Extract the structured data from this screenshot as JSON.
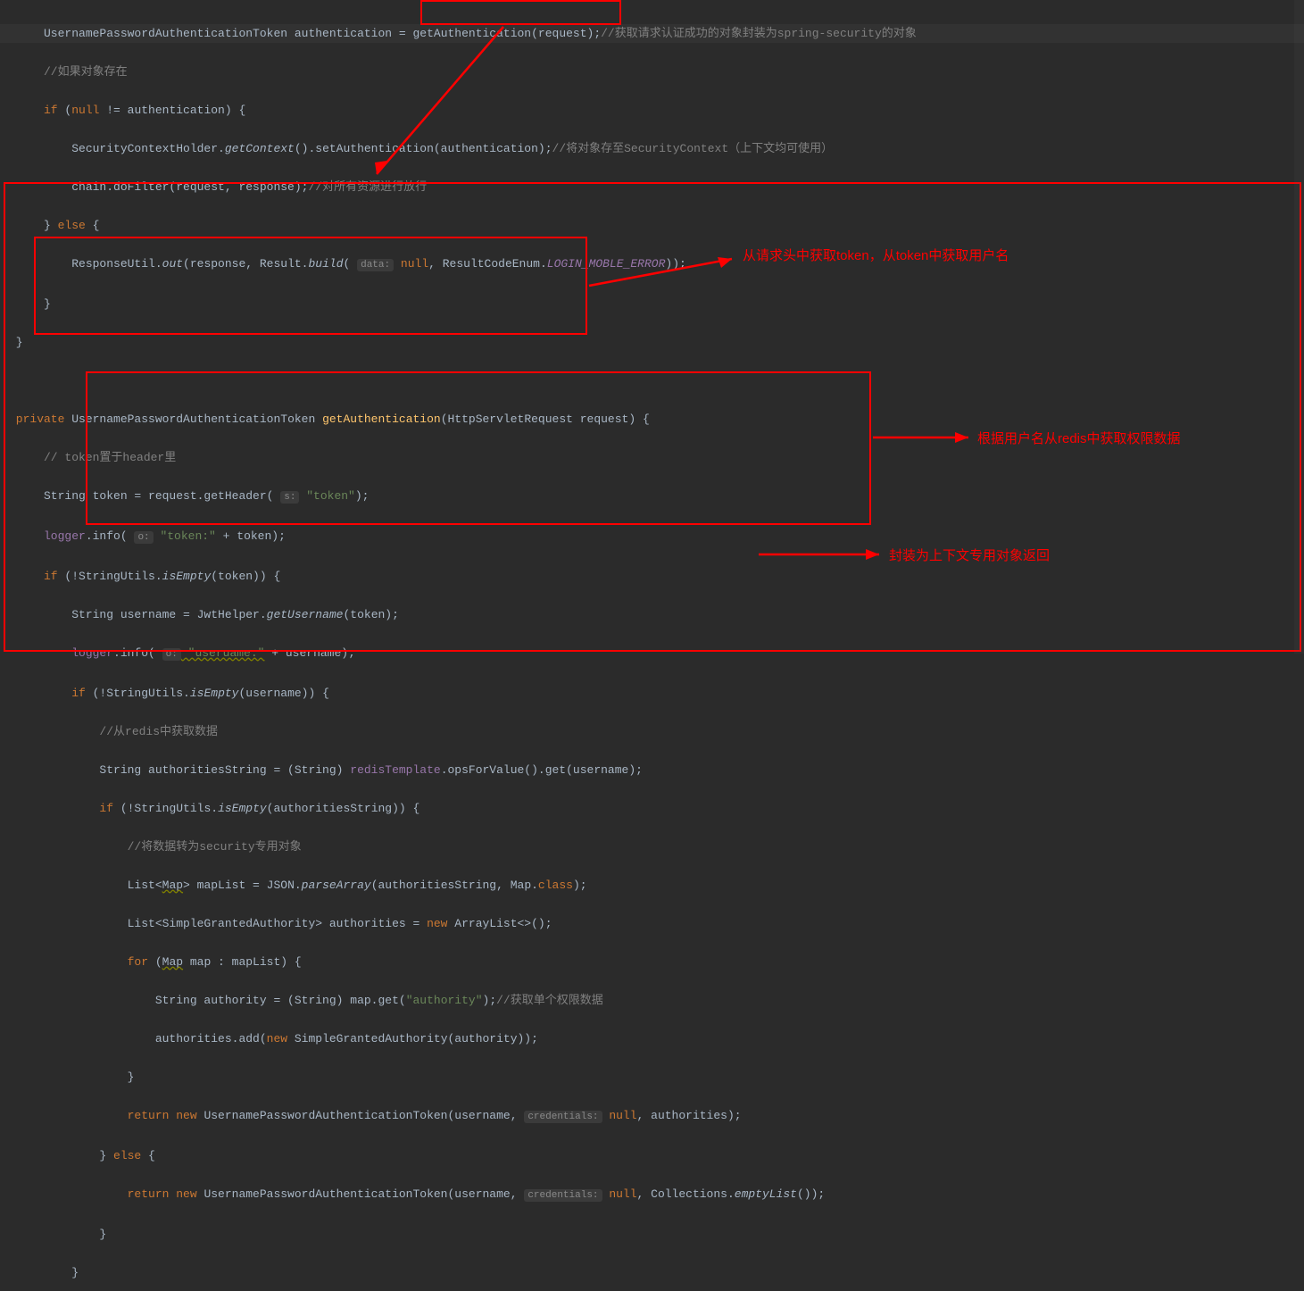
{
  "lines": {
    "l1_a": "     UsernamePasswordAuthenticationToken authentication = ",
    "l1_b": "getAuthentication",
    "l1_c": "(request);",
    "l1_d": "//获取请求认证成功的对象封装为spring-security的对象",
    "l2": "     //如果对象存在",
    "l3_a": "     if",
    "l3_b": " (",
    "l3_c": "null",
    "l3_d": " != authentication) {",
    "l4_a": "         SecurityContextHolder.",
    "l4_b": "getContext",
    "l4_c": "().setAuthentication(authentication);",
    "l4_d": "//将对象存至SecurityContext（上下文均可使用）",
    "l5_a": "         chain.doFilter(request, response);",
    "l5_b": "//对所有资源进行放行",
    "l6": "     } ",
    "l6_b": "else",
    "l6_c": " {",
    "l7_a": "         ResponseUtil.",
    "l7_b": "out",
    "l7_c": "(response, Result.",
    "l7_d": "build",
    "l7_e": "( ",
    "l7_hint": "data:",
    "l7_f": " null",
    "l7_g": ", ResultCodeEnum.",
    "l7_h": "LOGIN_MOBLE_ERROR",
    "l7_i": "));",
    "l8": "     }",
    "l9": " }",
    "l10": "",
    "m1_a": " private",
    "m1_b": " UsernamePasswordAuthenticationToken ",
    "m1_c": "getAuthentication",
    "m1_d": "(HttpServletRequest request) {",
    "m2": "     // token置于header里",
    "m3_a": "     String token = request.getHeader( ",
    "m3_hint": "s:",
    "m3_b": " \"token\"",
    "m3_c": ");",
    "m4_a": "     logger",
    "m4_b": ".info( ",
    "m4_hint": "o:",
    "m4_c": " \"token:\"",
    "m4_d": " + token);",
    "m5_a": "     if",
    "m5_b": " (!StringUtils.",
    "m5_c": "isEmpty",
    "m5_d": "(token)) {",
    "m6_a": "         String username = JwtHelper.",
    "m6_b": "getUsername",
    "m6_c": "(token);",
    "m7_a": "         logger",
    "m7_b": ".info( ",
    "m7_hint": "o:",
    "m7_c": " \"useruame:\"",
    "m7_d": " + username);",
    "m8_a": "         if",
    "m8_b": " (!StringUtils.",
    "m8_c": "isEmpty",
    "m8_d": "(username)) {",
    "m9": "             //从redis中获取数据",
    "m10_a": "             String authoritiesString = (String) ",
    "m10_b": "redisTemplate",
    "m10_c": ".opsForValue().get(username);",
    "m11_a": "             if",
    "m11_b": " (!StringUtils.",
    "m11_c": "isEmpty",
    "m11_d": "(authoritiesString)) {",
    "m12": "                 //将数据转为security专用对象",
    "m13_a": "                 List<",
    "m13_b": "Map",
    "m13_c": "> mapList = JSON.",
    "m13_d": "parseArray",
    "m13_e": "(authoritiesString, Map.",
    "m13_f": "class",
    "m13_g": ");",
    "m14_a": "                 List<SimpleGrantedAuthority> authorities = ",
    "m14_b": "new",
    "m14_c": " ArrayList<>();",
    "m15_a": "                 for",
    "m15_b": " (",
    "m15_c": "Map",
    "m15_d": " map : mapList) {",
    "m16_a": "                     String authority = (String) map.get(",
    "m16_b": "\"authority\"",
    "m16_c": ");",
    "m16_d": "//获取单个权限数据",
    "m17_a": "                     authorities.add(",
    "m17_b": "new",
    "m17_c": " SimpleGrantedAuthority(authority));",
    "m18": "                 }",
    "m19_a": "                 return new",
    "m19_b": " UsernamePasswordAuthenticationToken(username, ",
    "m19_hint": "credentials:",
    "m19_c": " null",
    "m19_d": ", authorities);",
    "m20_a": "             } ",
    "m20_b": "else",
    "m20_c": " {",
    "m21_a": "                 return new",
    "m21_b": " UsernamePasswordAuthenticationToken(username, ",
    "m21_hint": "credentials:",
    "m21_c": " null",
    "m21_d": ", Collections.",
    "m21_e": "emptyList",
    "m21_f": "());",
    "m22": "             }",
    "m23": "         }"
  },
  "annotations": {
    "a1": "从请求头中获取token，从token中获取用户名",
    "a2": "根据用户名从redis中获取权限数据",
    "a3": "封装为上下文专用对象返回"
  }
}
